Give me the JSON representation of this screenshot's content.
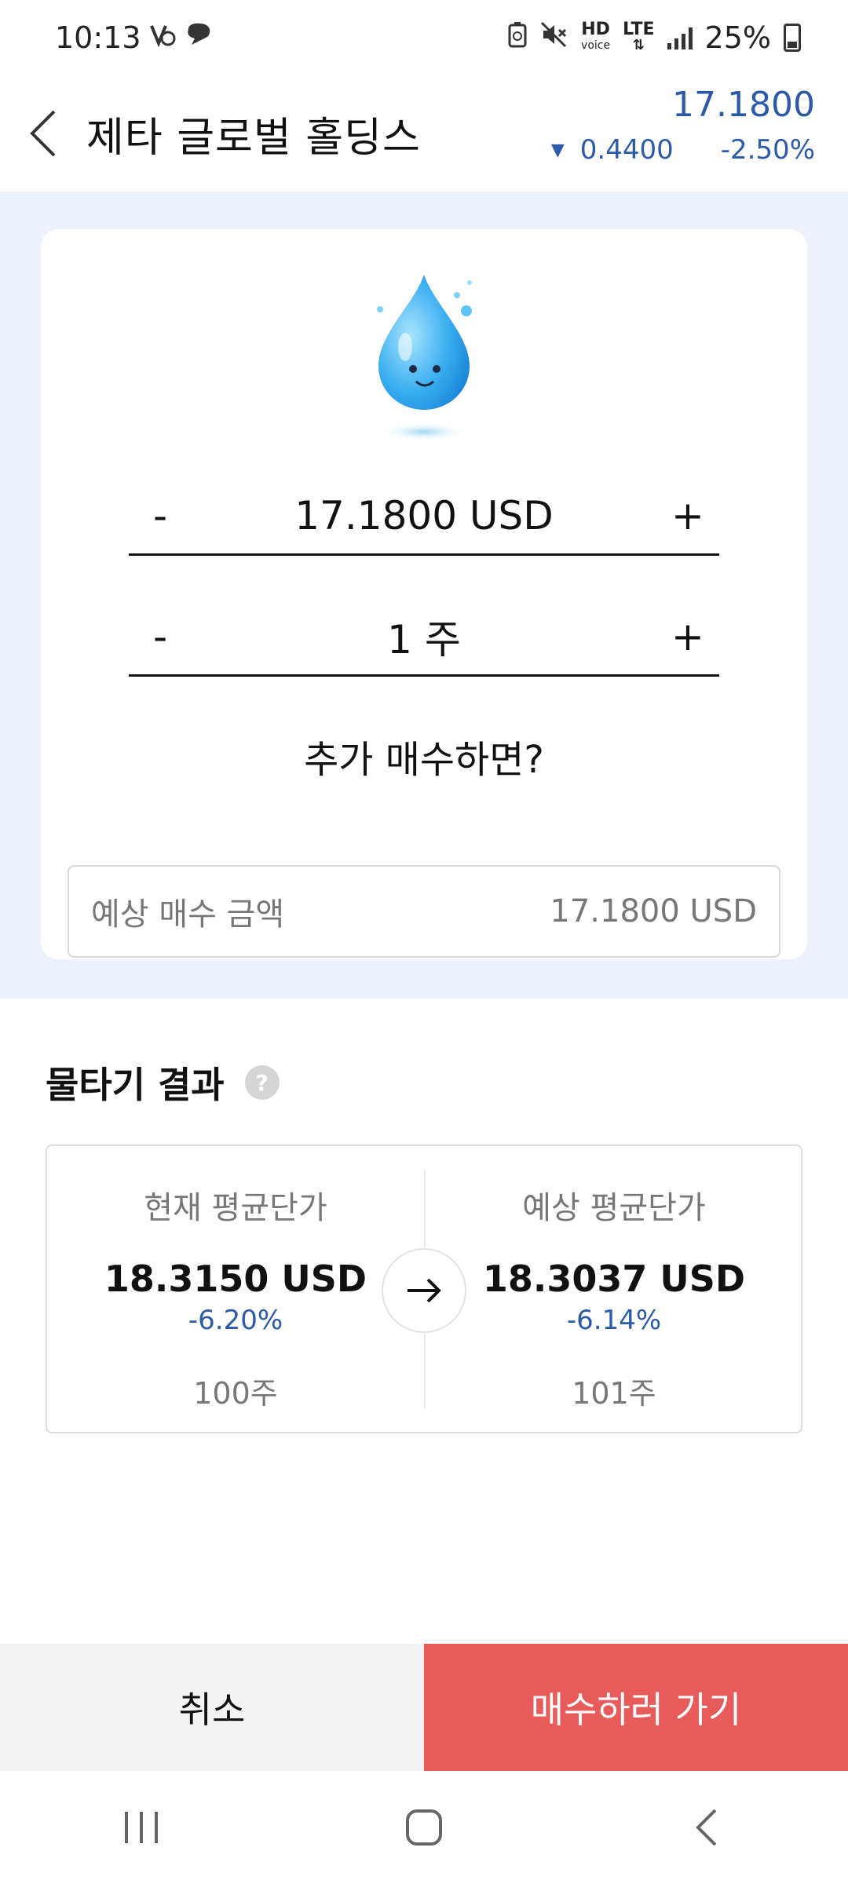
{
  "status_bar": {
    "time": "10:13",
    "hd_top": "HD",
    "hd_bottom": "voice",
    "lte": "LTE",
    "battery": "25%"
  },
  "header": {
    "title": "제타 글로벌 홀딩스",
    "price": "17.1800",
    "change": "0.4400",
    "change_pct": "-2.50%"
  },
  "calculator": {
    "price_value": "17.1800 USD",
    "minus_label": "-",
    "plus_label": "+",
    "quantity_value": "1 주",
    "question": "추가 매수하면?",
    "estimate_label": "예상 매수 금액",
    "estimate_value": "17.1800 USD"
  },
  "result": {
    "title": "물타기 결과",
    "help": "?",
    "current": {
      "label": "현재 평균단가",
      "price": "18.3150 USD",
      "pct": "-6.20%",
      "shares": "100주"
    },
    "expected": {
      "label": "예상 평균단가",
      "price": "18.3037 USD",
      "pct": "-6.14%",
      "shares": "101주"
    }
  },
  "actions": {
    "cancel": "취소",
    "buy": "매수하러 가기"
  },
  "colors": {
    "accent_blue": "#2a5aa8",
    "buy_red": "#e85b5b",
    "background_tint": "#edf1fb"
  }
}
